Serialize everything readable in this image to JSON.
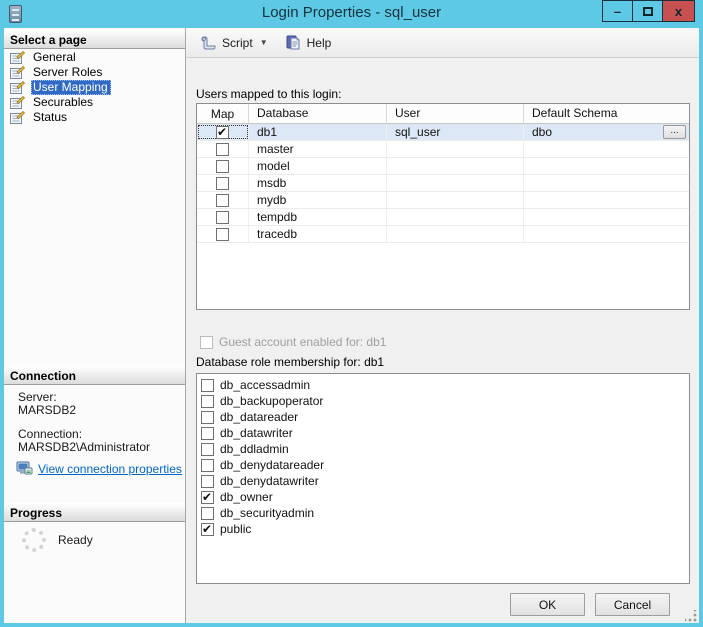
{
  "window": {
    "title": "Login Properties - sql_user",
    "controls": {
      "minimize": "–",
      "close": "x"
    }
  },
  "sidebar": {
    "select_page": {
      "header": "Select a page",
      "items": [
        {
          "label": "General",
          "selected": false
        },
        {
          "label": "Server Roles",
          "selected": false
        },
        {
          "label": "User Mapping",
          "selected": true
        },
        {
          "label": "Securables",
          "selected": false
        },
        {
          "label": "Status",
          "selected": false
        }
      ]
    },
    "connection": {
      "header": "Connection",
      "server_label": "Server:",
      "server_value": "MARSDB2",
      "connection_label": "Connection:",
      "connection_value": "MARSDB2\\Administrator",
      "link_label": "View connection properties"
    },
    "progress": {
      "header": "Progress",
      "status": "Ready"
    }
  },
  "toolbar": {
    "script_label": "Script",
    "help_label": "Help"
  },
  "main": {
    "users_mapped_label": "Users mapped to this login:",
    "table": {
      "columns": [
        "Map",
        "Database",
        "User",
        "Default Schema"
      ],
      "ellipsis_label": "...",
      "rows": [
        {
          "mapped": true,
          "database": "db1",
          "user": "sql_user",
          "schema": "dbo",
          "selected": true
        },
        {
          "mapped": false,
          "database": "master",
          "user": "",
          "schema": ""
        },
        {
          "mapped": false,
          "database": "model",
          "user": "",
          "schema": ""
        },
        {
          "mapped": false,
          "database": "msdb",
          "user": "",
          "schema": ""
        },
        {
          "mapped": false,
          "database": "mydb",
          "user": "",
          "schema": ""
        },
        {
          "mapped": false,
          "database": "tempdb",
          "user": "",
          "schema": ""
        },
        {
          "mapped": false,
          "database": "tracedb",
          "user": "",
          "schema": ""
        }
      ]
    },
    "guest_checkbox_label": "Guest account enabled for: db1",
    "guest_checked": false,
    "role_membership_label": "Database role membership for: db1",
    "roles": [
      {
        "name": "db_accessadmin",
        "checked": false
      },
      {
        "name": "db_backupoperator",
        "checked": false
      },
      {
        "name": "db_datareader",
        "checked": false
      },
      {
        "name": "db_datawriter",
        "checked": false
      },
      {
        "name": "db_ddladmin",
        "checked": false
      },
      {
        "name": "db_denydatareader",
        "checked": false
      },
      {
        "name": "db_denydatawriter",
        "checked": false
      },
      {
        "name": "db_owner",
        "checked": true
      },
      {
        "name": "db_securityadmin",
        "checked": false
      },
      {
        "name": "public",
        "checked": true
      }
    ]
  },
  "footer": {
    "ok_label": "OK",
    "cancel_label": "Cancel"
  },
  "colors": {
    "titlebar": "#5dc9e4",
    "close_button": "#c75050",
    "selection": "#316ac5",
    "row_highlight": "#dce8f5",
    "link": "#0066cc"
  }
}
